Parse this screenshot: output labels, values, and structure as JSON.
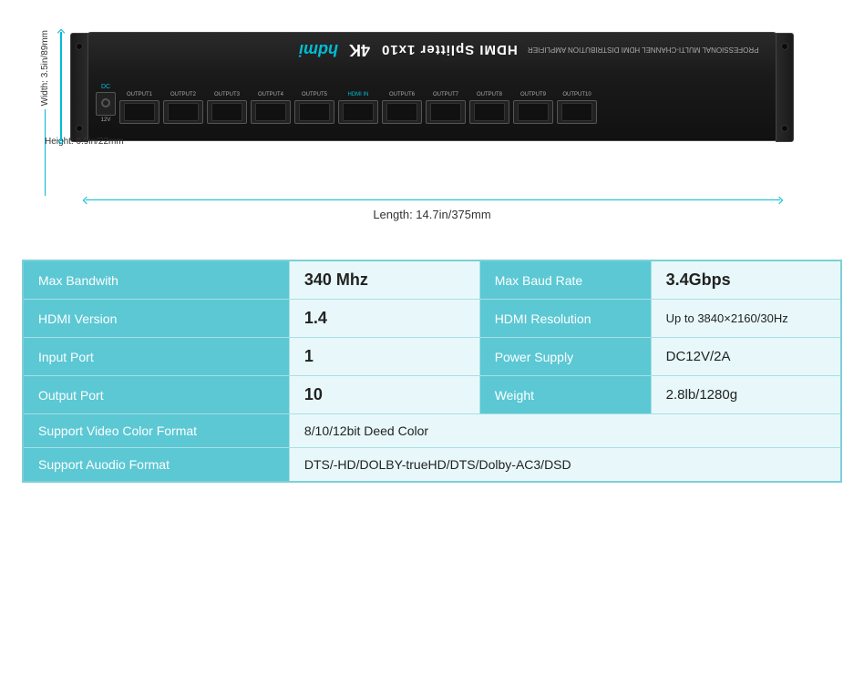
{
  "device": {
    "model": "HDMI Splitter 1x10",
    "brand": "4K",
    "dimensions": {
      "width_label": "Width: 3.5in/89mm",
      "height_label": "Height: 0.9in/22mm",
      "length_label": "Length: 14.7in/375mm"
    },
    "ports": [
      {
        "label": "DC\n12V",
        "type": "dc"
      },
      {
        "label": "OUTPUT1",
        "type": "hdmi"
      },
      {
        "label": "OUTPUT2",
        "type": "hdmi"
      },
      {
        "label": "OUTPUT3",
        "type": "hdmi"
      },
      {
        "label": "OUTPUT4",
        "type": "hdmi"
      },
      {
        "label": "OUTPUT5",
        "type": "hdmi"
      },
      {
        "label": "HDMI IN",
        "type": "hdmi"
      },
      {
        "label": "OUTPUT6",
        "type": "hdmi"
      },
      {
        "label": "OUTPUT7",
        "type": "hdmi"
      },
      {
        "label": "OUTPUT8",
        "type": "hdmi"
      },
      {
        "label": "OUTPUT9",
        "type": "hdmi"
      },
      {
        "label": "OUTPUT10",
        "type": "hdmi"
      }
    ]
  },
  "specs": {
    "rows": [
      {
        "col1_label": "Max Bandwith",
        "col1_value": "340 Mhz",
        "col2_label": "Max Baud Rate",
        "col2_value": "3.4Gbps"
      },
      {
        "col1_label": "HDMI Version",
        "col1_value": "1.4",
        "col2_label": "HDMI Resolution",
        "col2_value": "Up to 3840×2160/30Hz"
      },
      {
        "col1_label": "Input Port",
        "col1_value": "1",
        "col2_label": "Power Supply",
        "col2_value": "DC12V/2A"
      },
      {
        "col1_label": "Output Port",
        "col1_value": "10",
        "col2_label": "Weight",
        "col2_value": "2.8lb/1280g"
      }
    ],
    "wide_rows": [
      {
        "label": "Support Video Color Format",
        "value": "8/10/12bit Deed Color"
      },
      {
        "label": "Support  Auodio  Format",
        "value": "DTS/-HD/DOLBY-trueHD/DTS/Dolby-AC3/DSD"
      }
    ]
  },
  "colors": {
    "table_header_bg": "#5bc8d4",
    "table_value_bg": "#e8f8fa",
    "table_border": "#a8dfe5",
    "arrow_color": "#00bcd4"
  }
}
